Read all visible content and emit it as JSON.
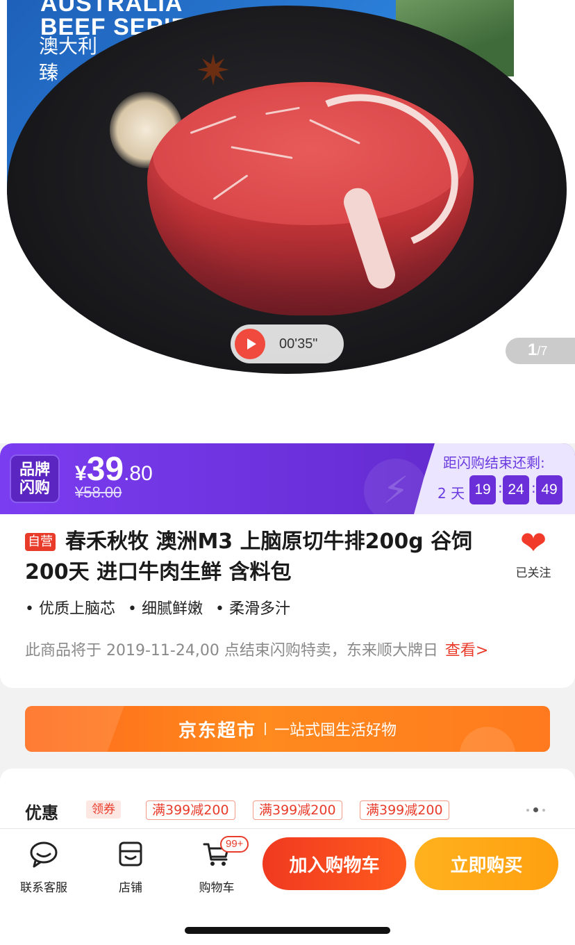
{
  "hero": {
    "box_title_line1": "AUSTRALIA",
    "box_title_line2": "BEEF SERIE",
    "box_sub_line1": "澳大利",
    "box_sub_line2": "臻",
    "video_time": "00'35\"",
    "page_current": "1",
    "page_total": "/7"
  },
  "flash": {
    "badge_line1": "品牌",
    "badge_line2": "闪购",
    "price_symbol": "¥",
    "price_int": "39",
    "price_dec": ".80",
    "price_original": "¥58.00",
    "countdown_title": "距闪购结束还剩:",
    "days": "2 天",
    "hours": "19",
    "minutes": "24",
    "seconds": "49",
    "sep": ":"
  },
  "product": {
    "self_tag": "自营",
    "title": "春禾秋牧 澳洲M3 上脑原切牛排200g 谷饲200天 进口牛肉生鲜 含料包",
    "fav_label": "已关注",
    "features": [
      "优质上脑芯",
      "细腻鲜嫩",
      "柔滑多汁"
    ],
    "notice": "此商品将于 2019-11-24,00 点结束闪购特卖，东来顺大牌日",
    "notice_link": "查看>"
  },
  "banner": {
    "main": "京东超市",
    "sub": "一站式囤生活好物"
  },
  "coupons": {
    "label": "优惠",
    "get_label": "领券",
    "items": [
      "满399减200",
      "满399减200",
      "满399减200"
    ]
  },
  "bottombar": {
    "service_label": "联系客服",
    "shop_label": "店铺",
    "cart_label": "购物车",
    "cart_badge": "99+",
    "add_to_cart": "加入购物车",
    "buy_now": "立即购买"
  },
  "colors": {
    "accent_red": "#e93b2a",
    "flash_purple": "#6a2fd8",
    "buy_orange": "#ffa010"
  },
  "icons": {
    "service": "chat-face-icon",
    "shop": "store-icon",
    "cart": "shopping-cart-icon",
    "favorite": "heart-icon",
    "play": "play-icon",
    "flash": "lightning-icon"
  }
}
